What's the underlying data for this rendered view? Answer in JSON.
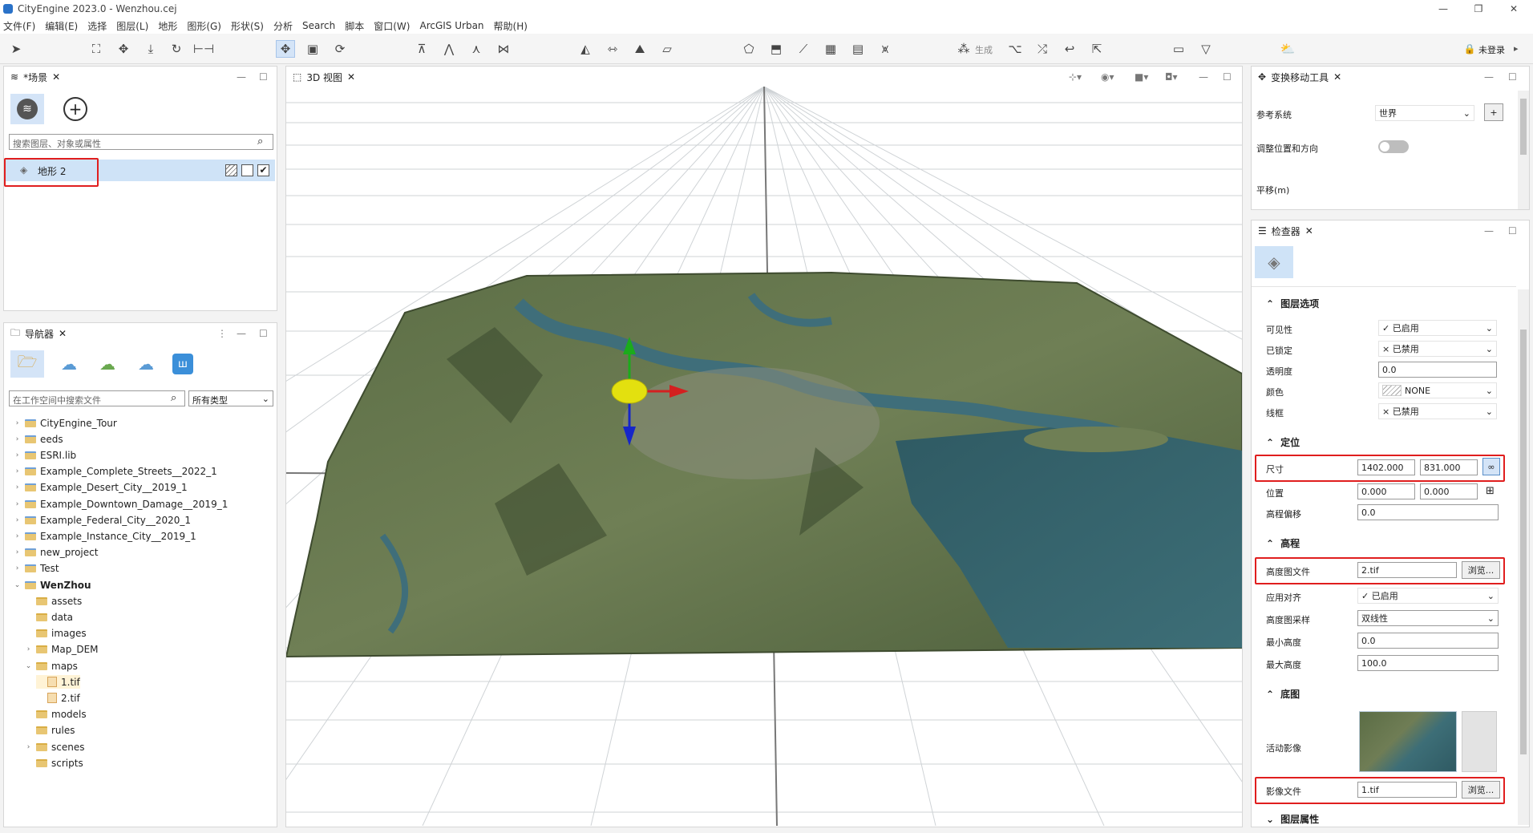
{
  "window": {
    "title": "CityEngine 2023.0 - Wenzhou.cej"
  },
  "menu": [
    "文件(F)",
    "编辑(E)",
    "选择",
    "图层(L)",
    "地形",
    "图形(G)",
    "形状(S)",
    "分析",
    "Search",
    "脚本",
    "窗口(W)",
    "ArcGIS Urban",
    "帮助(H)"
  ],
  "toolbar": {
    "generate_label": "生成",
    "login_label": "未登录"
  },
  "scene_panel": {
    "tab_label": "*场景",
    "search_placeholder": "搜索图层、对象或属性",
    "layer_name": "地形 2"
  },
  "navigator": {
    "tab_label": "导航器",
    "search_placeholder": "在工作空间中搜索文件",
    "type_filter": "所有类型",
    "tree": [
      {
        "label": "CityEngine_Tour",
        "level": 0,
        "type": "project",
        "twisty": ">"
      },
      {
        "label": "eeds",
        "level": 0,
        "type": "project",
        "twisty": ">"
      },
      {
        "label": "ESRI.lib",
        "level": 0,
        "type": "project",
        "twisty": ">"
      },
      {
        "label": "Example_Complete_Streets__2022_1",
        "level": 0,
        "type": "project",
        "twisty": ">"
      },
      {
        "label": "Example_Desert_City__2019_1",
        "level": 0,
        "type": "project",
        "twisty": ">"
      },
      {
        "label": "Example_Downtown_Damage__2019_1",
        "level": 0,
        "type": "project",
        "twisty": ">"
      },
      {
        "label": "Example_Federal_City__2020_1",
        "level": 0,
        "type": "project",
        "twisty": ">"
      },
      {
        "label": "Example_Instance_City__2019_1",
        "level": 0,
        "type": "project",
        "twisty": ">"
      },
      {
        "label": "new_project",
        "level": 0,
        "type": "project",
        "twisty": ">"
      },
      {
        "label": "Test",
        "level": 0,
        "type": "project",
        "twisty": ">"
      },
      {
        "label": "WenZhou",
        "level": 0,
        "type": "project",
        "twisty": "v",
        "bold": true
      },
      {
        "label": "assets",
        "level": 1,
        "type": "folder",
        "twisty": ""
      },
      {
        "label": "data",
        "level": 1,
        "type": "folder",
        "twisty": ""
      },
      {
        "label": "images",
        "level": 1,
        "type": "folder",
        "twisty": ""
      },
      {
        "label": "Map_DEM",
        "level": 1,
        "type": "folder",
        "twisty": ">"
      },
      {
        "label": "maps",
        "level": 1,
        "type": "folder",
        "twisty": "v"
      },
      {
        "label": "1.tif",
        "level": 2,
        "type": "file",
        "twisty": "",
        "selected": true
      },
      {
        "label": "2.tif",
        "level": 2,
        "type": "file",
        "twisty": ""
      },
      {
        "label": "models",
        "level": 1,
        "type": "folder",
        "twisty": ""
      },
      {
        "label": "rules",
        "level": 1,
        "type": "folder",
        "twisty": ""
      },
      {
        "label": "scenes",
        "level": 1,
        "type": "folder",
        "twisty": ">"
      },
      {
        "label": "scripts",
        "level": 1,
        "type": "folder",
        "twisty": ""
      }
    ]
  },
  "viewport": {
    "tab_label": "3D 视图"
  },
  "transform_panel": {
    "tab_label": "变换移动工具",
    "ref_system_label": "参考系统",
    "ref_system_value": "世界",
    "adjust_label": "调整位置和方向",
    "translate_label": "平移(m)"
  },
  "inspector": {
    "tab_label": "检查器",
    "layer_options": {
      "title": "图层选项",
      "visibility_label": "可见性",
      "visibility_value": "✓ 已启用",
      "locked_label": "已锁定",
      "locked_value": "× 已禁用",
      "opacity_label": "透明度",
      "opacity_value": "0.0",
      "color_label": "颜色",
      "color_value": "NONE",
      "wireframe_label": "线框",
      "wireframe_value": "× 已禁用"
    },
    "positioning": {
      "title": "定位",
      "size_label": "尺寸",
      "size_x": "1402.000",
      "size_y": "831.000",
      "position_label": "位置",
      "pos_x": "0.000",
      "pos_y": "0.000",
      "height_offset_label": "高程偏移",
      "height_offset": "0.0"
    },
    "elevation": {
      "title": "高程",
      "heightmap_label": "高度图文件",
      "heightmap_value": "2.tif",
      "browse_label": "浏览...",
      "align_label": "应用对齐",
      "align_value": "✓ 已启用",
      "sampling_label": "高度图采样",
      "sampling_value": "双线性",
      "min_label": "最小高度",
      "min_value": "0.0",
      "max_label": "最大高度",
      "max_value": "100.0"
    },
    "basemap": {
      "title": "底图",
      "active_label": "活动影像",
      "image_label": "影像文件",
      "image_value": "1.tif",
      "browse_label": "浏览..."
    },
    "layer_attributes_title": "图层属性"
  },
  "colors": {
    "accent": "#2a72c8",
    "highlight_red": "#e01e1e",
    "selection": "#cfe3f7"
  }
}
